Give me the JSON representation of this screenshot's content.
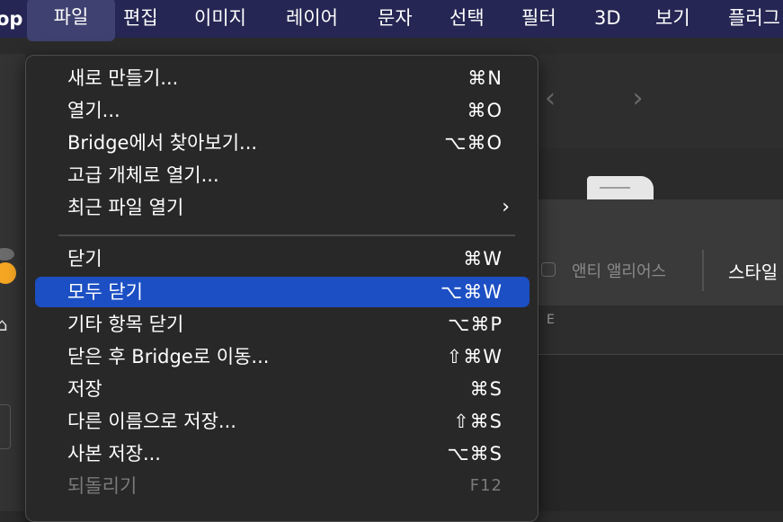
{
  "menubar": {
    "app_fragment": "op",
    "items": [
      "파일",
      "편집",
      "이미지",
      "레이어",
      "문자",
      "선택",
      "필터",
      "3D",
      "보기",
      "플러그"
    ]
  },
  "background": {
    "nav_arrows": "‹ ›",
    "options": {
      "anti_alias_label": "앤티 앨리어스",
      "style_label": "스타일"
    },
    "ruler_mark": "E"
  },
  "file_menu": {
    "items": [
      {
        "label": "새로 만들기...",
        "shortcut": "⌘N"
      },
      {
        "label": "열기...",
        "shortcut": "⌘O"
      },
      {
        "label": "Bridge에서 찾아보기...",
        "shortcut": "⌥⌘O"
      },
      {
        "label": "고급 개체로 열기...",
        "shortcut": ""
      },
      {
        "label": "최근 파일 열기",
        "shortcut": "›"
      },
      {
        "label": "닫기",
        "shortcut": "⌘W"
      },
      {
        "label": "모두 닫기",
        "shortcut": "⌥⌘W",
        "selected": true
      },
      {
        "label": "기타 항목 닫기",
        "shortcut": "⌥⌘P"
      },
      {
        "label": "닫은 후 Bridge로 이동...",
        "shortcut": "⇧⌘W"
      },
      {
        "label": "저장",
        "shortcut": "⌘S"
      },
      {
        "label": "다른 이름으로 저장...",
        "shortcut": "⇧⌘S"
      },
      {
        "label": "사본 저장...",
        "shortcut": "⌥⌘S"
      },
      {
        "label": "되돌리기",
        "shortcut": "F12",
        "disabled": true
      }
    ]
  },
  "colors": {
    "menubar_bg": "#252653",
    "selected_bg": "#1c4fc4",
    "menu_bg": "#282828"
  }
}
